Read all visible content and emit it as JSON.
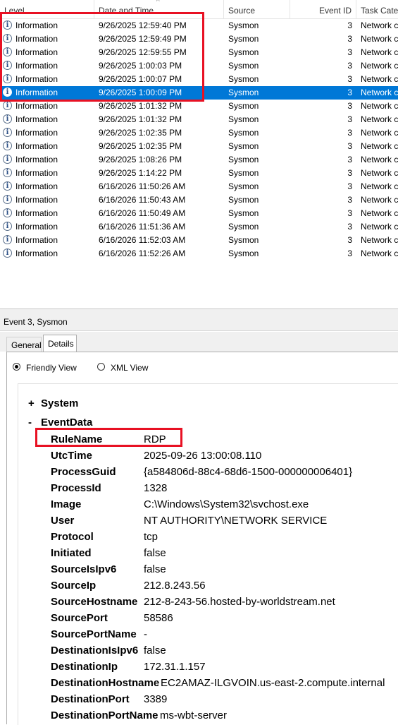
{
  "grid": {
    "columns": {
      "level": "Level",
      "date": "Date and Time",
      "source": "Source",
      "event_id": "Event ID",
      "task": "Task Categ"
    },
    "sort_arrow": "^",
    "rows": [
      {
        "level": "Information",
        "date": "9/26/2025 12:59:40 PM",
        "source": "Sysmon",
        "event_id": "3",
        "task": "Network c"
      },
      {
        "level": "Information",
        "date": "9/26/2025 12:59:49 PM",
        "source": "Sysmon",
        "event_id": "3",
        "task": "Network c"
      },
      {
        "level": "Information",
        "date": "9/26/2025 12:59:55 PM",
        "source": "Sysmon",
        "event_id": "3",
        "task": "Network c"
      },
      {
        "level": "Information",
        "date": "9/26/2025 1:00:03 PM",
        "source": "Sysmon",
        "event_id": "3",
        "task": "Network c"
      },
      {
        "level": "Information",
        "date": "9/26/2025 1:00:07 PM",
        "source": "Sysmon",
        "event_id": "3",
        "task": "Network c"
      },
      {
        "level": "Information",
        "date": "9/26/2025 1:00:09 PM",
        "source": "Sysmon",
        "event_id": "3",
        "task": "Network c"
      },
      {
        "level": "Information",
        "date": "9/26/2025 1:01:32 PM",
        "source": "Sysmon",
        "event_id": "3",
        "task": "Network c"
      },
      {
        "level": "Information",
        "date": "9/26/2025 1:01:32 PM",
        "source": "Sysmon",
        "event_id": "3",
        "task": "Network c"
      },
      {
        "level": "Information",
        "date": "9/26/2025 1:02:35 PM",
        "source": "Sysmon",
        "event_id": "3",
        "task": "Network c"
      },
      {
        "level": "Information",
        "date": "9/26/2025 1:02:35 PM",
        "source": "Sysmon",
        "event_id": "3",
        "task": "Network c"
      },
      {
        "level": "Information",
        "date": "9/26/2025 1:08:26 PM",
        "source": "Sysmon",
        "event_id": "3",
        "task": "Network c"
      },
      {
        "level": "Information",
        "date": "9/26/2025 1:14:22 PM",
        "source": "Sysmon",
        "event_id": "3",
        "task": "Network c"
      },
      {
        "level": "Information",
        "date": "6/16/2026 11:50:26 AM",
        "source": "Sysmon",
        "event_id": "3",
        "task": "Network c"
      },
      {
        "level": "Information",
        "date": "6/16/2026 11:50:43 AM",
        "source": "Sysmon",
        "event_id": "3",
        "task": "Network c"
      },
      {
        "level": "Information",
        "date": "6/16/2026 11:50:49 AM",
        "source": "Sysmon",
        "event_id": "3",
        "task": "Network c"
      },
      {
        "level": "Information",
        "date": "6/16/2026 11:51:36 AM",
        "source": "Sysmon",
        "event_id": "3",
        "task": "Network c"
      },
      {
        "level": "Information",
        "date": "6/16/2026 11:52:03 AM",
        "source": "Sysmon",
        "event_id": "3",
        "task": "Network c"
      },
      {
        "level": "Information",
        "date": "6/16/2026 11:52:26 AM",
        "source": "Sysmon",
        "event_id": "3",
        "task": "Network c"
      }
    ],
    "selected_index": 5,
    "info_icon_glyph": "i"
  },
  "detail": {
    "title": "Event 3, Sysmon",
    "tabs": {
      "general": "General",
      "details": "Details"
    },
    "active_tab": "details",
    "views": {
      "friendly": "Friendly View",
      "xml": "XML View"
    },
    "selected_view": "friendly",
    "system_sign": "+",
    "system_label": "System",
    "eventdata_sign": "-",
    "eventdata_label": "EventData",
    "fields": [
      {
        "key": "RuleName",
        "value": "RDP"
      },
      {
        "key": "UtcTime",
        "value": "2025-09-26 13:00:08.110"
      },
      {
        "key": "ProcessGuid",
        "value": "{a584806d-88c4-68d6-1500-000000006401}"
      },
      {
        "key": "ProcessId",
        "value": "1328"
      },
      {
        "key": "Image",
        "value": "C:\\Windows\\System32\\svchost.exe"
      },
      {
        "key": "User",
        "value": "NT AUTHORITY\\NETWORK SERVICE"
      },
      {
        "key": "Protocol",
        "value": "tcp"
      },
      {
        "key": "Initiated",
        "value": "false"
      },
      {
        "key": "SourceIsIpv6",
        "value": "false"
      },
      {
        "key": "SourceIp",
        "value": "212.8.243.56"
      },
      {
        "key": "SourceHostname",
        "value": "212-8-243-56.hosted-by-worldstream.net"
      },
      {
        "key": "SourcePort",
        "value": "58586"
      },
      {
        "key": "SourcePortName",
        "value": "-"
      },
      {
        "key": "DestinationIsIpv6",
        "value": "false"
      },
      {
        "key": "DestinationIp",
        "value": "172.31.1.157"
      },
      {
        "key": "DestinationHostname",
        "value": "EC2AMAZ-ILGVOIN.us-east-2.compute.internal"
      },
      {
        "key": "DestinationPort",
        "value": "3389"
      },
      {
        "key": "DestinationPortName",
        "value": "ms-wbt-server"
      }
    ]
  },
  "colors": {
    "selection": "#0078d7",
    "highlight_box": "#e81123"
  }
}
